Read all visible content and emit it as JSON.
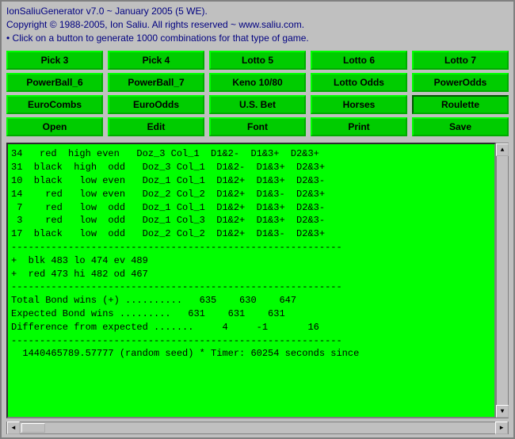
{
  "window": {
    "title": "IonSaliuGenerator v7.0"
  },
  "header": {
    "line1": "IonSaliuGenerator v7.0 ~ January 2005 (5 WE).",
    "line2": "Copyright © 1988-2005, Ion Saliu. All rights reserved ~ www.saliu.com.",
    "line3": "• Click on a button to generate 1000 combinations for that type of game."
  },
  "buttons": {
    "row1": [
      {
        "label": "Pick 3",
        "name": "pick3-button"
      },
      {
        "label": "Pick 4",
        "name": "pick4-button"
      },
      {
        "label": "Lotto 5",
        "name": "lotto5-button"
      },
      {
        "label": "Lotto 6",
        "name": "lotto6-button"
      },
      {
        "label": "Lotto 7",
        "name": "lotto7-button"
      }
    ],
    "row2": [
      {
        "label": "PowerBall_6",
        "name": "powerball6-button"
      },
      {
        "label": "PowerBall_7",
        "name": "powerball7-button"
      },
      {
        "label": "Keno 10/80",
        "name": "keno-button"
      },
      {
        "label": "Lotto Odds",
        "name": "lottoodds-button"
      },
      {
        "label": "PowerOdds",
        "name": "powerodds-button"
      }
    ],
    "row3": [
      {
        "label": "EuroCombs",
        "name": "eurocombs-button"
      },
      {
        "label": "EuroOdds",
        "name": "euroodds-button"
      },
      {
        "label": "U.S. Bet",
        "name": "usbet-button"
      },
      {
        "label": "Horses",
        "name": "horses-button"
      },
      {
        "label": "Roulette",
        "name": "roulette-button"
      }
    ],
    "row4": [
      {
        "label": "Open",
        "name": "open-button"
      },
      {
        "label": "Edit",
        "name": "edit-button"
      },
      {
        "label": "Font",
        "name": "font-button"
      },
      {
        "label": "Print",
        "name": "print-button"
      },
      {
        "label": "Save",
        "name": "save-button"
      }
    ]
  },
  "output": {
    "content": "34   red  high even   Doz_3 Col_1  D1&2-  D1&3+  D2&3+\n31  black  high  odd   Doz_3 Col_1  D1&2-  D1&3+  D2&3+\n10  black   low even   Doz_1 Col_1  D1&2+  D1&3+  D2&3-\n14    red   low even   Doz_2 Col_2  D1&2+  D1&3-  D2&3+\n 7    red   low  odd   Doz_1 Col_1  D1&2+  D1&3+  D2&3-\n 3    red   low  odd   Doz_1 Col_3  D1&2+  D1&3+  D2&3-\n17  black   low  odd   Doz_2 Col_2  D1&2+  D1&3-  D2&3+\n----------------------------------------------------------\n+  blk 483 lo 474 ev 489\n+  red 473 hi 482 od 467\n----------------------------------------------------------\nTotal Bond wins (+) ..........   635    630    647\nExpected Bond wins .........   631    631    631\nDifference from expected .......     4     -1       16\n----------------------------------------------------------\n  1440465789.57777 (random seed) * Timer: 60254 seconds since"
  }
}
